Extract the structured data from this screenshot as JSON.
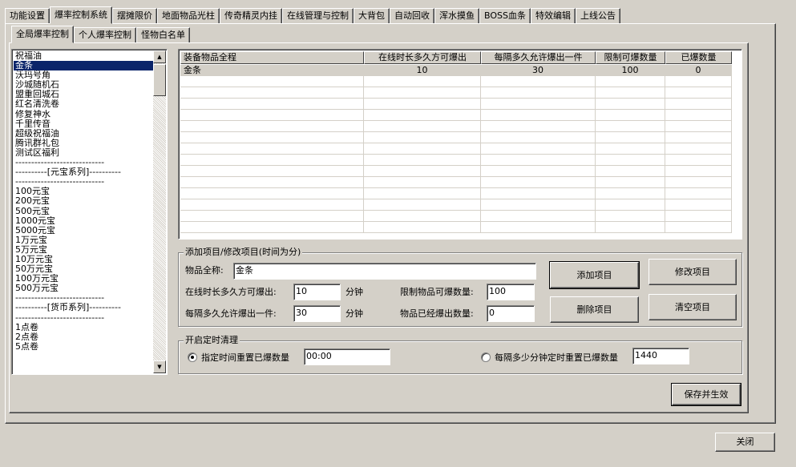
{
  "main_tabs": [
    "功能设置",
    "爆率控制系统",
    "摆摊限价",
    "地面物品光柱",
    "传奇精灵内挂",
    "在线管理与控制",
    "大背包",
    "自动回收",
    "浑水摸鱼",
    "BOSS血条",
    "特效编辑",
    "上线公告"
  ],
  "sub_tabs": [
    "全局爆率控制",
    "个人爆率控制",
    "怪物白名单"
  ],
  "item_list": [
    "祝福油",
    "金条",
    "沃玛号角",
    "沙城随机石",
    "盟重回城石",
    "红名清洗卷",
    "修复神水",
    "千里传音",
    "超级祝福油",
    "腾讯群礼包",
    "测试区福利",
    "----------------------------",
    "----------[元宝系列]----------",
    "----------------------------",
    "100元宝",
    "200元宝",
    "500元宝",
    "1000元宝",
    "5000元宝",
    "1万元宝",
    "5万元宝",
    "10万元宝",
    "50万元宝",
    "100万元宝",
    "500万元宝",
    "----------------------------",
    "----------[货币系列]----------",
    "----------------------------",
    "1点卷",
    "2点卷",
    "5点卷"
  ],
  "grid": {
    "headers": [
      "装备物品全程",
      "在线时长多久方可爆出",
      "每隔多久允许爆出一件",
      "限制可爆数量",
      "已爆数量"
    ],
    "rows": [
      [
        "金条",
        "10",
        "30",
        "100",
        "0"
      ]
    ]
  },
  "edit_group": {
    "title": "添加项目/修改项目(时间为分)",
    "name_label": "物品全称:",
    "name_value": "金条",
    "online_label": "在线时长多久方可爆出:",
    "online_value": "10",
    "online_unit": "分钟",
    "interval_label": "每隔多久允许爆出一件:",
    "interval_value": "30",
    "interval_unit": "分钟",
    "limit_label": "限制物品可爆数量:",
    "limit_value": "100",
    "dropped_label": "物品已经爆出数量:",
    "dropped_value": "0",
    "add_button": "添加项目",
    "modify_button": "修改项目",
    "delete_button": "删除项目",
    "clear_button": "清空项目"
  },
  "timer_group": {
    "title": "开启定时清理",
    "option1_label": "指定时间重置已爆数量",
    "option1_value": "00:00",
    "option2_label": "每隔多少分钟定时重置已爆数量",
    "option2_value": "1440"
  },
  "save_button": "保存并生效",
  "close_button": "关闭"
}
